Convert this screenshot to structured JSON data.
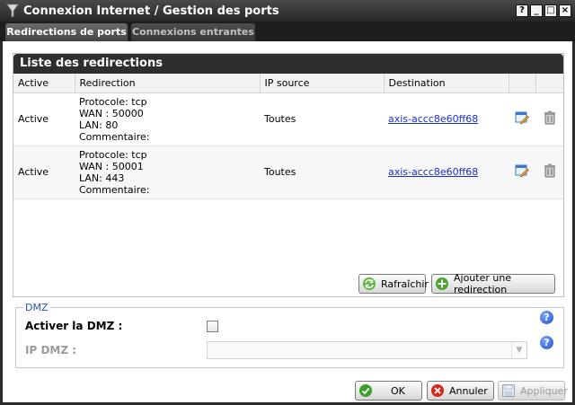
{
  "window": {
    "title": "Connexion Internet / Gestion des ports",
    "controls": [
      "?",
      "_",
      "□",
      "×"
    ]
  },
  "tabs": [
    {
      "label": "Redirections de ports",
      "active": true
    },
    {
      "label": "Connexions entrantes",
      "active": false
    }
  ],
  "panel": {
    "title": "Liste des redirections",
    "columns": [
      "Active",
      "Redirection",
      "IP source",
      "Destination"
    ],
    "rows": [
      {
        "active": "Active",
        "redirection": [
          "Protocole: tcp",
          "WAN : 50000",
          "LAN: 80",
          "Commentaire:"
        ],
        "ip_source": "Toutes",
        "destination": "axis-accc8e60ff68"
      },
      {
        "active": "Active",
        "redirection": [
          "Protocole: tcp",
          "WAN : 50001",
          "LAN: 443",
          "Commentaire:"
        ],
        "ip_source": "Toutes",
        "destination": "axis-accc8e60ff68"
      }
    ]
  },
  "actions": {
    "refresh_label": "Rafraîchir",
    "add_label": "Ajouter une redirection"
  },
  "dmz": {
    "legend": "DMZ",
    "enable_label": "Activer la DMZ :",
    "enable_checked": false,
    "ip_label": "IP DMZ :",
    "ip_value": ""
  },
  "footer": {
    "ok_label": "OK",
    "cancel_label": "Annuler",
    "apply_label": "Appliquer"
  },
  "colors": {
    "titlebar": "#2e2e2e",
    "link": "#1a2ed8",
    "legend": "#2d4fb5",
    "ok_green": "#3aa02a",
    "cancel_red": "#d12a1c"
  }
}
